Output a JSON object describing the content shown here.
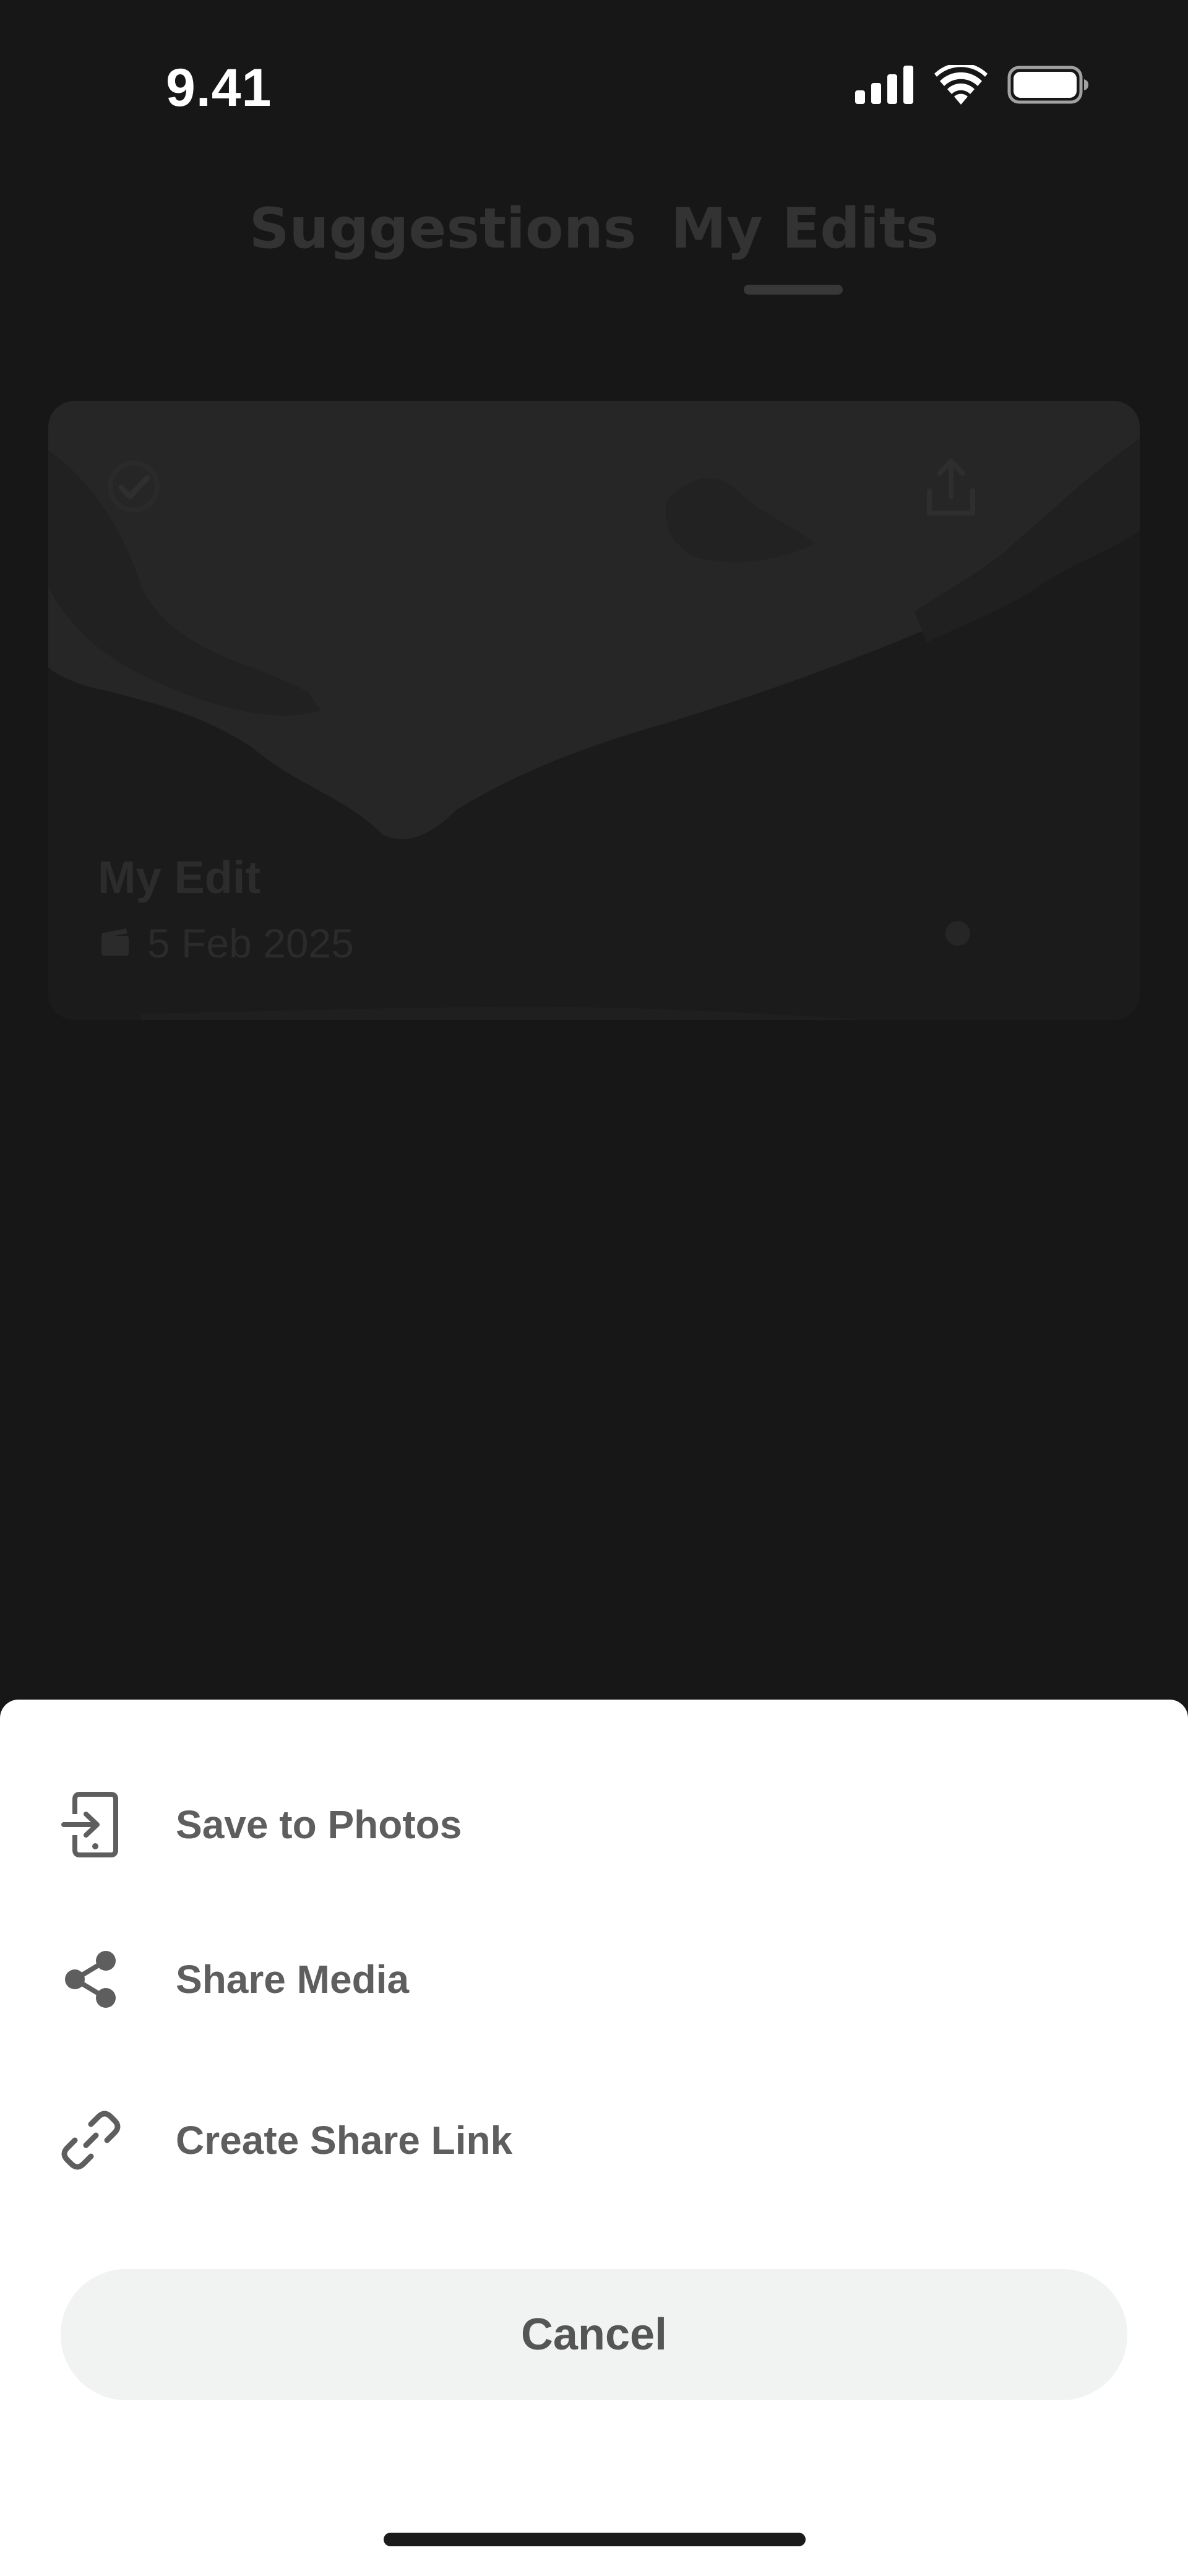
{
  "status_bar": {
    "time": "9.41",
    "icons": [
      "cellular-signal-icon",
      "wifi-icon",
      "battery-icon"
    ]
  },
  "tabs": [
    {
      "label": "Suggestions",
      "selected": false
    },
    {
      "label": "My Edits",
      "selected": true
    }
  ],
  "edit_card": {
    "title": "My Edit",
    "date": "5 Feb 2025",
    "icons": [
      "checkmark-select-icon",
      "export-icon",
      "clapperboard-icon"
    ]
  },
  "action_sheet": {
    "items": [
      {
        "label": "Save to Photos",
        "icon": "save-to-phone-icon"
      },
      {
        "label": "Share Media",
        "icon": "share-icon"
      },
      {
        "label": "Create Share Link",
        "icon": "link-icon"
      }
    ],
    "cancel_label": "Cancel"
  },
  "colors": {
    "background": "#171717",
    "sheet_background": "#ffffff",
    "sheet_text": "#5e5e5e",
    "cancel_background": "#f1f2f2"
  }
}
